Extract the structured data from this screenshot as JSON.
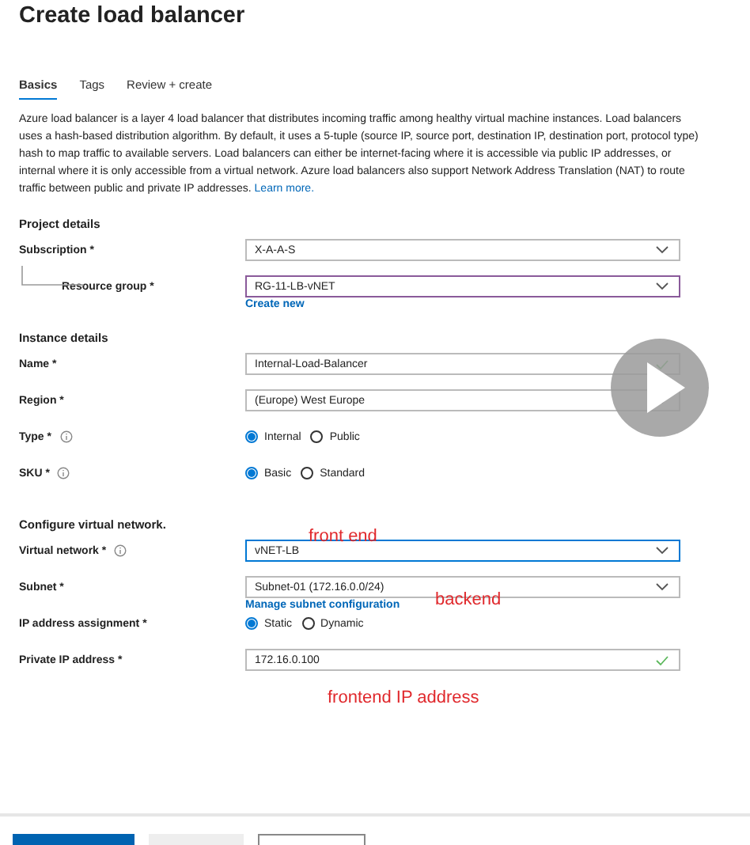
{
  "title": "Create load balancer",
  "tabs": [
    {
      "label": "Basics",
      "selected": true
    },
    {
      "label": "Tags",
      "selected": false
    },
    {
      "label": "Review + create",
      "selected": false
    }
  ],
  "description": {
    "text": "Azure load balancer is a layer 4 load balancer that distributes incoming traffic among healthy virtual machine instances. Load balancers uses a hash-based distribution algorithm. By default, it uses a 5-tuple (source IP, source port, destination IP, destination port, protocol type) hash to map traffic to available servers. Load balancers can either be internet-facing where it is accessible via public IP addresses, or internal where it is only accessible from a virtual network. Azure load balancers also support Network Address Translation (NAT) to route traffic between public and private IP addresses.",
    "link": "Learn more."
  },
  "sections": [
    {
      "heading": "Project details",
      "fields": [
        {
          "label": "Subscription *",
          "kind": "select",
          "value": "X-A-A-S"
        },
        {
          "label": "Resource group *",
          "kind": "select",
          "value": "RG-11-LB-vNET",
          "nested": true,
          "hovered": true,
          "link": "Create new"
        }
      ]
    },
    {
      "heading": "Instance details",
      "fields": [
        {
          "label": "Name *",
          "kind": "text",
          "value": "Internal-Load-Balancer",
          "valid": true
        },
        {
          "label": "Region *",
          "kind": "select",
          "value": "(Europe) West Europe"
        },
        {
          "label": "Type *",
          "kind": "radio",
          "info": true,
          "options": [
            {
              "label": "Internal",
              "selected": true
            },
            {
              "label": "Public",
              "selected": false
            }
          ]
        },
        {
          "label": "SKU *",
          "kind": "radio",
          "info": true,
          "options": [
            {
              "label": "Basic",
              "selected": true
            },
            {
              "label": "Standard",
              "selected": false
            }
          ]
        }
      ]
    },
    {
      "heading": "Configure virtual network.",
      "fields": [
        {
          "label": "Virtual network *",
          "kind": "select",
          "value": "vNET-LB",
          "info": true,
          "focused": true
        },
        {
          "label": "Subnet *",
          "kind": "select",
          "value": "Subnet-01 (172.16.0.0/24)",
          "link": "Manage subnet configuration"
        },
        {
          "label": "IP address assignment *",
          "kind": "radio",
          "options": [
            {
              "label": "Static",
              "selected": true
            },
            {
              "label": "Dynamic",
              "selected": false
            }
          ]
        },
        {
          "label": "Private IP address *",
          "kind": "text",
          "value": "172.16.0.100",
          "valid": true
        }
      ]
    }
  ],
  "annotations": [
    {
      "text": "front end"
    },
    {
      "text": "backend"
    },
    {
      "text": "frontend IP address"
    }
  ],
  "footer_buttons": [
    {
      "kind": "primary"
    },
    {
      "kind": "disabled"
    },
    {
      "kind": "default"
    }
  ]
}
